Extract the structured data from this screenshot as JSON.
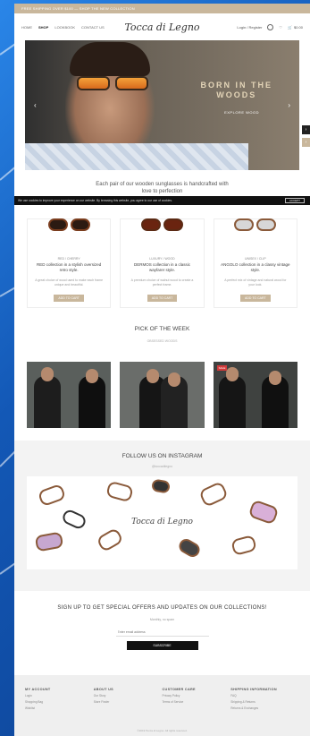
{
  "topbar": {
    "text": "FREE SHIPPING OVER $100 — SHOP THE NEW COLLECTION"
  },
  "header": {
    "nav": [
      "HOME",
      "SHOP",
      "LOOKBOOK",
      "CONTACT US"
    ],
    "logo": "Tocca di Legno",
    "account": "Login / Register",
    "cart": "$0.00"
  },
  "hero": {
    "title_line1": "BORN IN THE",
    "title_line2": "WOODS",
    "button": "EXPLORE WOOD",
    "prev": "‹",
    "next": "›"
  },
  "tagline": "Each pair of our wooden sunglasses is handcrafted with love to perfection",
  "cookie": {
    "text": "We use cookies to improve your experience on our website. By browsing this website, you agree to our use of cookies.",
    "button": "ACCEPT"
  },
  "products": [
    {
      "category": "RED / CHERRY",
      "name": "RED collection in a stylish oversized retro style.",
      "desc": "A great choice of wood used to make each frame unique and beautiful.",
      "button": "ADD TO CART",
      "frame_color": "#7a3d1e"
    },
    {
      "category": "LUXURY / WOOD",
      "name": "DERMOS collection in a classic wayfarer style.",
      "desc": "A premium choice of walnut wood to create a perfect frame.",
      "button": "ADD TO CART",
      "frame_color": "#5b2a14"
    },
    {
      "category": "UNISEX / CLIP",
      "name": "ANGOLO collection in a classy vintage style.",
      "desc": "A perfect mix of vintage and natural wood for your look.",
      "button": "ADD TO CART",
      "frame_color": "#8a5a3a"
    }
  ],
  "pick_of_week": {
    "title": "PICK OF THE WEEK",
    "subtitle": "OBSESSED WOODS",
    "badge": "SALE"
  },
  "instagram": {
    "title": "FOLLOW US ON INSTAGRAM",
    "handle": "@toccadilegno",
    "logo": "Tocca di Legno"
  },
  "signup": {
    "title": "SIGN UP TO GET SPECIAL OFFERS AND UPDATES ON OUR COLLECTIONS!",
    "subtitle": "Monthly, no spam",
    "placeholder": "Enter email address",
    "button": "SUBSCRIBE"
  },
  "footer": {
    "columns": [
      {
        "title": "MY ACCOUNT",
        "links": [
          "Login",
          "Shopping Bag",
          "Wishlist"
        ]
      },
      {
        "title": "ABOUT US",
        "links": [
          "Our Story",
          "Store Finder"
        ]
      },
      {
        "title": "CUSTOMER CARE",
        "links": [
          "Privacy Policy",
          "Terms of Service"
        ]
      },
      {
        "title": "SHIPPING INFORMATION",
        "links": [
          "FAQ",
          "Shipping & Returns",
          "Returns & Exchanges"
        ]
      }
    ],
    "copyright": "©2019 Tocca di Legno. All rights reserved."
  },
  "colors": {
    "accent": "#c9b79c",
    "background": "#1a6fd1"
  }
}
